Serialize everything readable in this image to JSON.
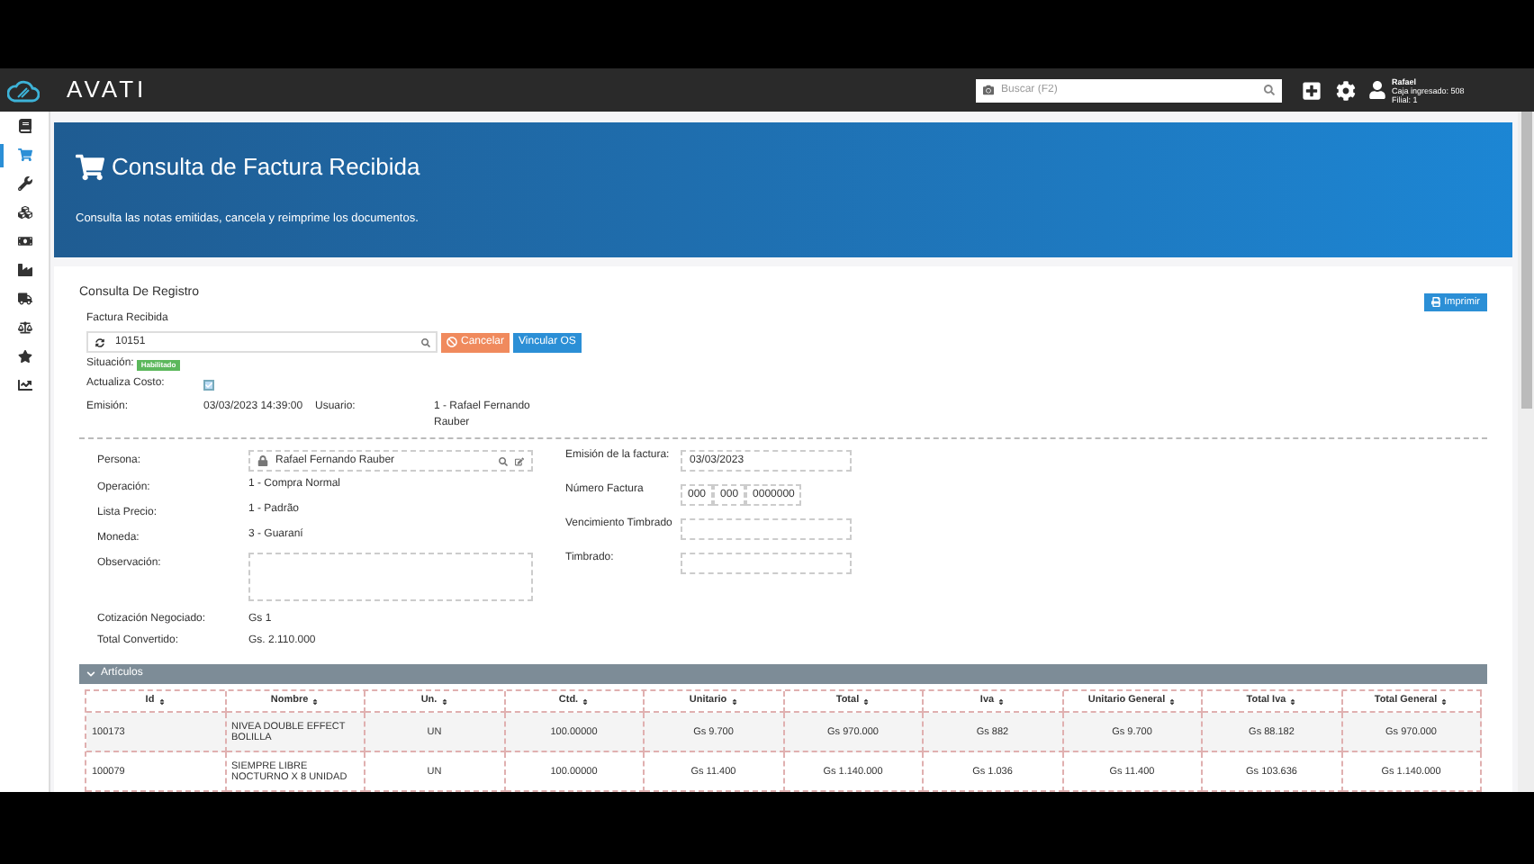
{
  "app_bar": {
    "logo": "AVATI",
    "search": {
      "placeholder": "Buscar (F2)"
    },
    "user": {
      "name": "Rafael",
      "line_1": "Caja ingresado: 508",
      "line_2": "Filial: 1"
    }
  },
  "sidebar": {
    "items": [
      {
        "kind": "book",
        "selected": false
      },
      {
        "kind": "cart",
        "selected": true
      },
      {
        "kind": "wrench",
        "selected": false
      },
      {
        "kind": "cubes",
        "selected": false
      },
      {
        "kind": "money",
        "selected": false
      },
      {
        "kind": "industry",
        "selected": false
      },
      {
        "kind": "truck",
        "selected": false
      },
      {
        "kind": "scale",
        "selected": false
      },
      {
        "kind": "star",
        "selected": false
      },
      {
        "kind": "chart",
        "selected": false
      }
    ]
  },
  "banner": {
    "title": "Consulta de Factura Recibida",
    "subtitle": "Consulta las notas emitidas, cancela y reimprime los documentos."
  },
  "section_title": "Consulta De Registro",
  "print_button": "Imprimir",
  "factura": {
    "label": "Factura Recibida",
    "value": "10151",
    "cancel_button": "Cancelar",
    "link_button": "Vincular OS"
  },
  "situacion": {
    "label": "Situación:",
    "badge": "Habilitado"
  },
  "actualiza_costo": {
    "label": "Actualiza Costo:",
    "checked": true
  },
  "emision": {
    "label": "Emisión:",
    "value": "03/03/2023 14:39:00",
    "user_label": "Usuario:",
    "user_value": "1 - Rafael Fernando Rauber"
  },
  "left_fields": [
    {
      "label": "Persona:",
      "value": "Rafael Fernando Rauber",
      "kind": "lookup"
    },
    {
      "label": "Operación:",
      "value": "1 - Compra Normal",
      "kind": "text"
    },
    {
      "label": "Lista Precio:",
      "value": "1 - Padrão",
      "kind": "text"
    },
    {
      "label": "Moneda:",
      "value": "3 - Guaraní",
      "kind": "text"
    },
    {
      "label": "Observación:",
      "kind": "textarea"
    }
  ],
  "right_fields": [
    {
      "label": "Emisión de la factura:",
      "value": "03/03/2023",
      "kind": "input"
    },
    {
      "label": "Número Factura",
      "parts": [
        "000",
        "000",
        "0000000"
      ],
      "kind": "number"
    },
    {
      "label": "Vencimiento Timbrado",
      "kind": "input"
    },
    {
      "label": "Timbrado:",
      "kind": "input"
    }
  ],
  "totals": [
    {
      "label": "Cotización Negociado:",
      "value": "Gs 1"
    },
    {
      "label": "Total Convertido:",
      "value": "Gs. 2.110.000"
    }
  ],
  "articulos": {
    "title": "Artículos",
    "expanded": true,
    "columns": [
      "Id",
      "Nombre",
      "Un.",
      "Ctd.",
      "Unitario",
      "Total",
      "Iva",
      "Unitario General",
      "Total Iva",
      "Total General"
    ],
    "rows": [
      [
        "100173",
        "NIVEA DOUBLE EFFECT BOLILLA",
        "UN",
        "100.00000",
        "Gs 9.700",
        "Gs 970.000",
        "Gs 882",
        "Gs 9.700",
        "Gs 88.182",
        "Gs 970.000"
      ],
      [
        "100079",
        "SIEMPRE LIBRE NOCTURNO X 8 UNIDAD",
        "UN",
        "100.00000",
        "Gs 11.400",
        "Gs 1.140.000",
        "Gs 1.036",
        "Gs 11.400",
        "Gs 103.636",
        "Gs 1.140.000"
      ]
    ]
  }
}
